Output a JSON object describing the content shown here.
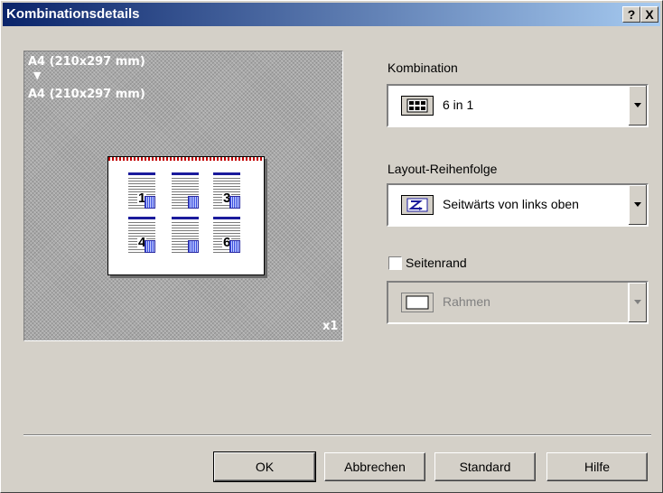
{
  "window": {
    "title": "Kombinationsdetails",
    "help_btn": "?",
    "close_btn": "X"
  },
  "preview": {
    "from_size": "A4 (210x297 mm)",
    "arrow": "▼",
    "to_size": "A4 (210x297 mm)",
    "copies": "x1",
    "pages": [
      "1",
      "",
      "3",
      "4",
      "",
      "6"
    ]
  },
  "kombination": {
    "label": "Kombination",
    "value": "6 in 1"
  },
  "layout": {
    "label": "Layout-Reihenfolge",
    "value": "Seitwärts von links oben"
  },
  "seitenrand": {
    "label": "Seitenrand",
    "checked": false,
    "value": "Rahmen"
  },
  "buttons": {
    "ok": "OK",
    "cancel": "Abbrechen",
    "standard": "Standard",
    "help": "Hilfe"
  }
}
